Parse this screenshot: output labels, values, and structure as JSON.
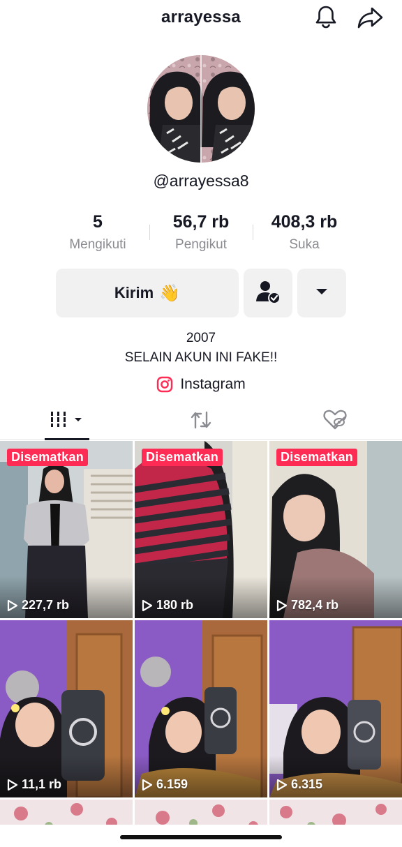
{
  "header": {
    "username": "arrayessa",
    "bell_icon": "bell-icon",
    "share_icon": "share-icon"
  },
  "profile": {
    "handle": "@arrayessa8"
  },
  "stats": [
    {
      "value": "5",
      "label": "Mengikuti"
    },
    {
      "value": "56,7 rb",
      "label": "Pengikut"
    },
    {
      "value": "408,3 rb",
      "label": "Suka"
    }
  ],
  "actions": {
    "send_label": "Kirim",
    "send_emoji": "👋",
    "follow_icon": "user-check-icon",
    "more_icon": "caret-down-icon"
  },
  "bio": {
    "line1": "2007",
    "line2": "SELAIN AKUN INI FAKE!!"
  },
  "link": {
    "label": "Instagram",
    "icon": "instagram-icon"
  },
  "tabs": [
    {
      "icon": "videos-grid-icon",
      "active": true
    },
    {
      "icon": "repost-icon",
      "active": false
    },
    {
      "icon": "liked-hidden-icon",
      "active": false
    }
  ],
  "videos": [
    {
      "pinned": "Disematkan",
      "views": "227,7 rb"
    },
    {
      "pinned": "Disematkan",
      "views": "180 rb"
    },
    {
      "pinned": "Disematkan",
      "views": "782,4 rb"
    },
    {
      "pinned": "",
      "views": "11,1 rb"
    },
    {
      "pinned": "",
      "views": "6.159"
    },
    {
      "pinned": "",
      "views": "6.315"
    }
  ],
  "colors": {
    "accent": "#fe2c55",
    "text": "#161823",
    "muted": "#8a8b91",
    "button_bg": "#f1f1f2"
  }
}
